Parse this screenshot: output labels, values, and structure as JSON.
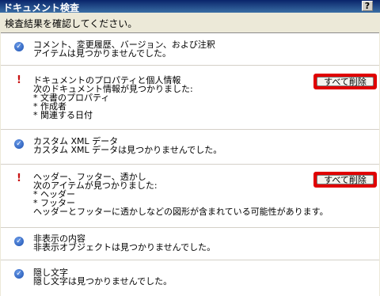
{
  "window": {
    "title": "ドキュメント検査",
    "help_label": "?",
    "close_label": "×"
  },
  "subtitle": "検査結果を確認してください。",
  "sections": [
    {
      "status": "ok",
      "lines": [
        "コメント、変更履歴、バージョン、および注釈",
        "アイテムは見つかりませんでした。"
      ]
    },
    {
      "status": "found",
      "lines": [
        "ドキュメントのプロパティと個人情報",
        "次のドキュメント情報が見つかりました:",
        "* 文書のプロパティ",
        "* 作成者",
        "* 関連する日付"
      ],
      "button_label": "すべて削除"
    },
    {
      "status": "ok",
      "lines": [
        "カスタム XML データ",
        "カスタム XML データは見つかりませんでした。"
      ]
    },
    {
      "status": "found",
      "lines": [
        "ヘッダー、フッター、透かし",
        "次のアイテムが見つかりました:",
        "* ヘッダー",
        "* フッター",
        "ヘッダーとフッターに透かしなどの図形が含まれている可能性があります。"
      ],
      "button_label": "すべて削除"
    },
    {
      "status": "ok",
      "lines": [
        "非表示の内容",
        "非表示オブジェクトは見つかりませんでした。"
      ]
    },
    {
      "status": "ok",
      "lines": [
        "隠し文字",
        "隠し文字は見つかりませんでした。"
      ]
    }
  ],
  "icons": {
    "ok": "check-circle-icon",
    "found": "exclamation-icon"
  },
  "colors": {
    "highlight": "#e00000",
    "ok_icon": "#1a4fb0",
    "warn_icon": "#c81212"
  }
}
